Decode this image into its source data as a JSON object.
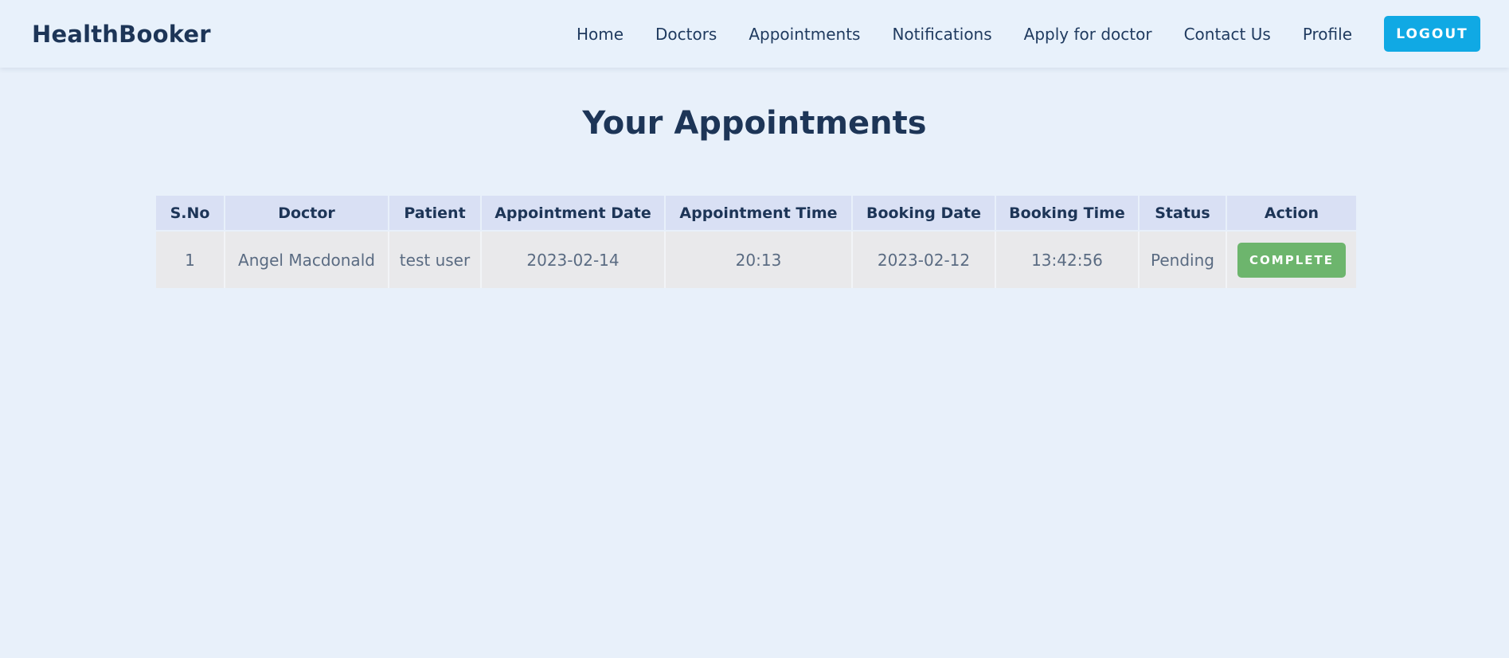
{
  "brand": "HealthBooker",
  "nav": {
    "items": [
      {
        "label": "Home"
      },
      {
        "label": "Doctors"
      },
      {
        "label": "Appointments"
      },
      {
        "label": "Notifications"
      },
      {
        "label": "Apply for doctor"
      },
      {
        "label": "Contact Us"
      },
      {
        "label": "Profile"
      }
    ],
    "logout_label": "LOGOUT"
  },
  "page": {
    "title": "Your Appointments"
  },
  "table": {
    "headers": [
      "S.No",
      "Doctor",
      "Patient",
      "Appointment Date",
      "Appointment Time",
      "Booking Date",
      "Booking Time",
      "Status",
      "Action"
    ],
    "rows": [
      {
        "sno": "1",
        "doctor": "Angel Macdonald",
        "patient": "test user",
        "appointment_date": "2023-02-14",
        "appointment_time": "20:13",
        "booking_date": "2023-02-12",
        "booking_time": "13:42:56",
        "status": "Pending",
        "action_label": "COMPLETE"
      }
    ]
  },
  "colors": {
    "background": "#e8f0fa",
    "brand_text": "#1d3557",
    "logout_button": "#10a9e4",
    "complete_button": "#6db56d",
    "table_header": "#d9e0f4",
    "table_row": "#e9e9eb"
  }
}
